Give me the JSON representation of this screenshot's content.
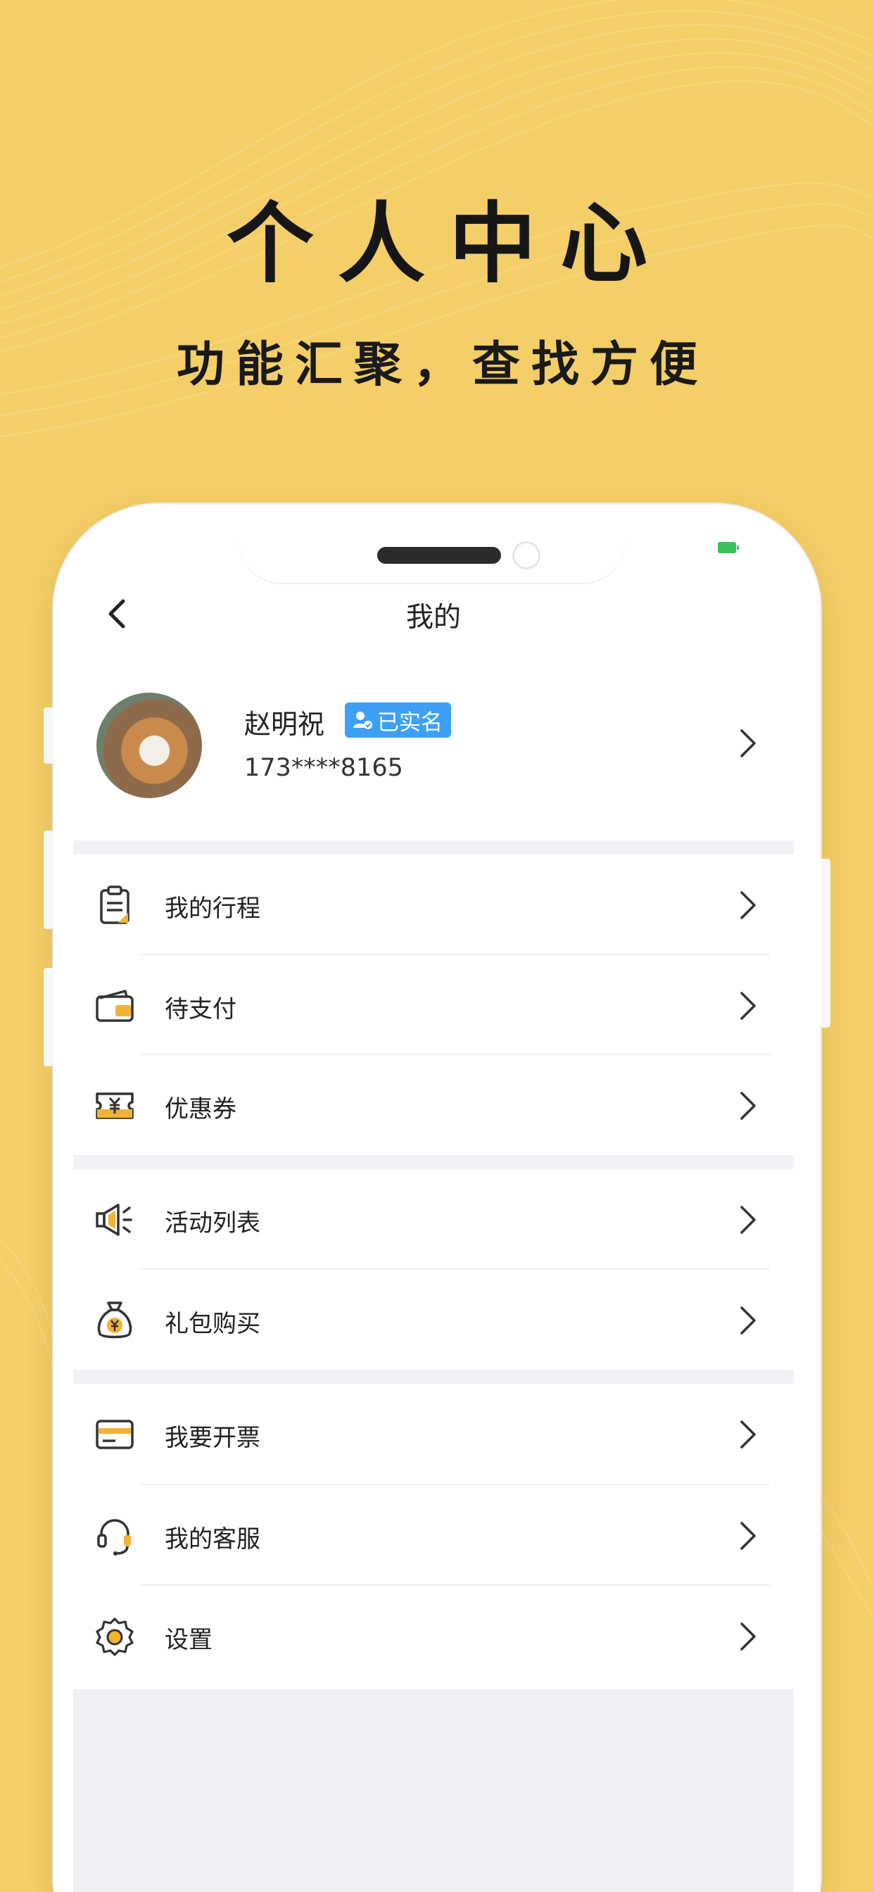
{
  "promo": {
    "title": "个人中心",
    "subtitle": "功能汇聚，查找方便"
  },
  "nav": {
    "title": "我的",
    "back_icon": "chevron-left-icon"
  },
  "profile": {
    "name": "赵明祝",
    "verified_label": "已实名",
    "phone": "173****8165"
  },
  "menu": {
    "group1": [
      {
        "label": "我的行程",
        "icon": "clipboard-icon"
      },
      {
        "label": "待支付",
        "icon": "wallet-icon"
      },
      {
        "label": "优惠券",
        "icon": "coupon-icon"
      }
    ],
    "group2": [
      {
        "label": "活动列表",
        "icon": "megaphone-icon"
      },
      {
        "label": "礼包购买",
        "icon": "money-bag-icon"
      }
    ],
    "group3": [
      {
        "label": "我要开票",
        "icon": "card-icon"
      },
      {
        "label": "我的客服",
        "icon": "headset-icon"
      },
      {
        "label": "设置",
        "icon": "gear-icon"
      }
    ]
  },
  "colors": {
    "background": "#F4CE67",
    "accent": "#F2B234",
    "badge": "#3DA0F5",
    "separator": "#F1F1F5"
  }
}
